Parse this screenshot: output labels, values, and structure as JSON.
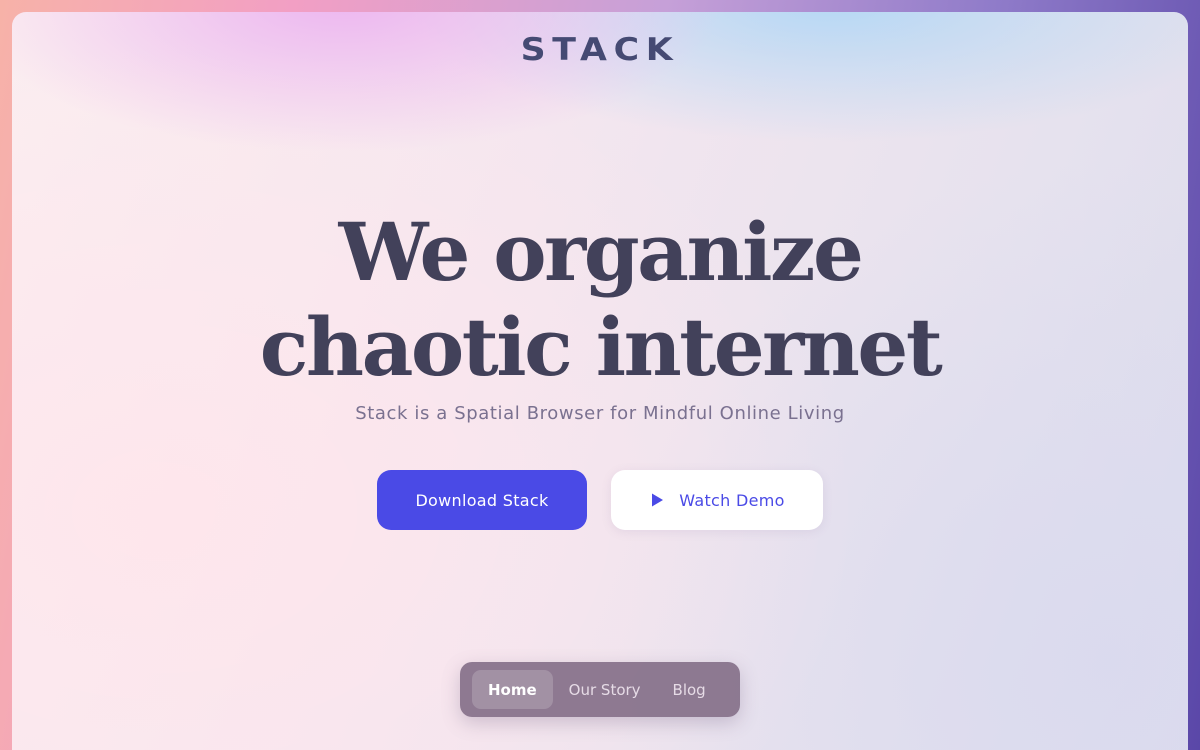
{
  "brand": {
    "logo_text": "STACK"
  },
  "hero": {
    "headline_line1": "We organize",
    "headline_line2": "chaotic internet",
    "subtitle": "Stack is a Spatial Browser for Mindful Online Living"
  },
  "actions": {
    "primary_label": "Download Stack",
    "secondary_label": "Watch Demo",
    "secondary_icon": "play-icon"
  },
  "nav": {
    "items": [
      {
        "label": "Home",
        "active": true
      },
      {
        "label": "Our Story",
        "active": false
      },
      {
        "label": "Blog",
        "active": false
      }
    ]
  },
  "colors": {
    "accent": "#4a4ae6",
    "heading": "#42415a",
    "logo": "#454a73",
    "subtitle": "#7a7190"
  }
}
